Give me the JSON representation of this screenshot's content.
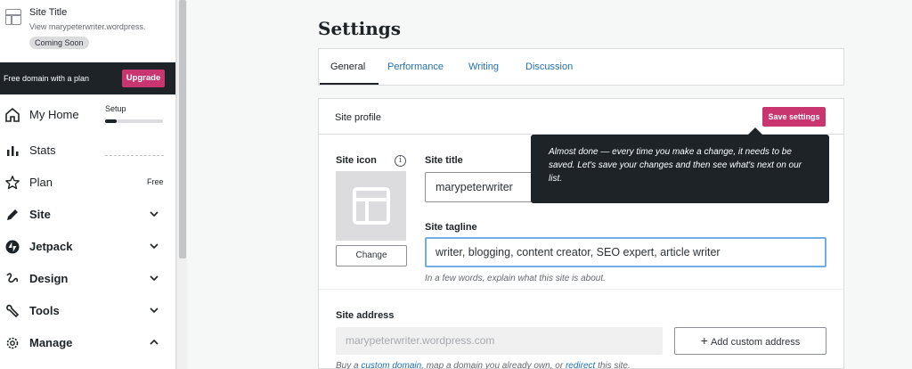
{
  "sidebar": {
    "site_title": "Site Title",
    "site_url": "View marypeterwriter.wordpress.",
    "status_badge": "Coming Soon",
    "domain_banner": "Free domain with a plan",
    "upgrade_label": "Upgrade",
    "setup_label": "Setup",
    "setup_progress": 0.2,
    "plan_badge": "Free",
    "items": [
      {
        "label": "My Home",
        "icon": "home-icon"
      },
      {
        "label": "Stats",
        "icon": "stats-icon"
      },
      {
        "label": "Plan",
        "icon": "star-icon"
      },
      {
        "label": "Site",
        "icon": "pencil-icon"
      },
      {
        "label": "Jetpack",
        "icon": "jetpack-icon"
      },
      {
        "label": "Design",
        "icon": "brush-icon"
      },
      {
        "label": "Tools",
        "icon": "wrench-icon"
      },
      {
        "label": "Manage",
        "icon": "gear-icon"
      }
    ]
  },
  "main": {
    "title": "Settings",
    "tabs": [
      {
        "label": "General",
        "active": true
      },
      {
        "label": "Performance",
        "active": false
      },
      {
        "label": "Writing",
        "active": false
      },
      {
        "label": "Discussion",
        "active": false
      }
    ],
    "card": {
      "header_title": "Site profile",
      "save_label": "Save settings",
      "site_icon_label": "Site icon",
      "change_label": "Change",
      "site_title_label": "Site title",
      "site_title_value": "marypeterwriter",
      "tagline_label": "Site tagline",
      "tagline_value": "writer, blogging, content creator, SEO expert, article writer",
      "tagline_help": "In a few words, explain what this site is about.",
      "address_label": "Site address",
      "address_value": "marypeterwriter.wordpress.com",
      "add_address_label": "Add custom address",
      "footer_prefix": "Buy a ",
      "footer_link1": "custom domain,",
      "footer_middle": " map a domain you already own, or ",
      "footer_link2": "redirect",
      "footer_suffix": " this site."
    },
    "tooltip": "Almost done — every time you make a change, it needs to be saved. Let's save your changes and then see what's next on our list."
  },
  "colors": {
    "accent": "#c9356e",
    "link": "#2271b1",
    "dark": "#1d2327"
  }
}
